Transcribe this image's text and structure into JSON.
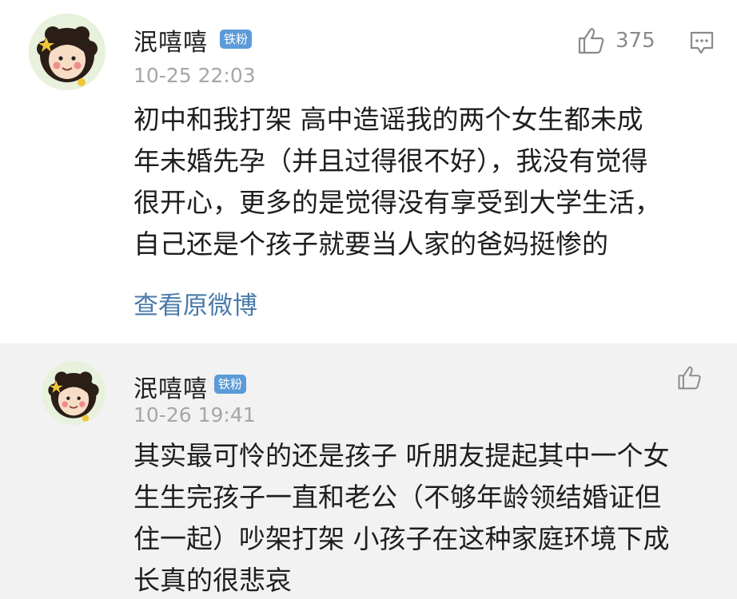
{
  "comments": [
    {
      "user": {
        "name": "泯嘻嘻",
        "badge": "铁粉"
      },
      "time": "10-25 22:03",
      "likes": "375",
      "text_lines": [
        "初中和我打架 高中造谣我的两个女生都未成",
        "年未婚先孕（并且过得很不好），我没有觉得",
        "很开心，更多的是觉得没有享受到大学生活，",
        "自己还是个孩子就要当人家的爸妈挺惨的"
      ],
      "link": "查看原微博",
      "icons": [
        "thumbs-up-icon",
        "comment-icon"
      ]
    },
    {
      "user": {
        "name": "泯嘻嘻",
        "badge": "铁粉"
      },
      "time": "10-26 19:41",
      "text_lines": [
        "其实最可怜的还是孩子 听朋友提起其中一个女",
        "生生完孩子一直和老公（不够年龄领结婚证但",
        "住一起）吵架打架 小孩子在这种家庭环境下成",
        "长真的很悲哀"
      ],
      "icons": [
        "thumbs-up-icon"
      ]
    }
  ],
  "colors": {
    "badge": "#5b9bd8",
    "link": "#4a7aa8",
    "reply_bg": "#f2f2f2",
    "meta": "#a6a6a6"
  }
}
